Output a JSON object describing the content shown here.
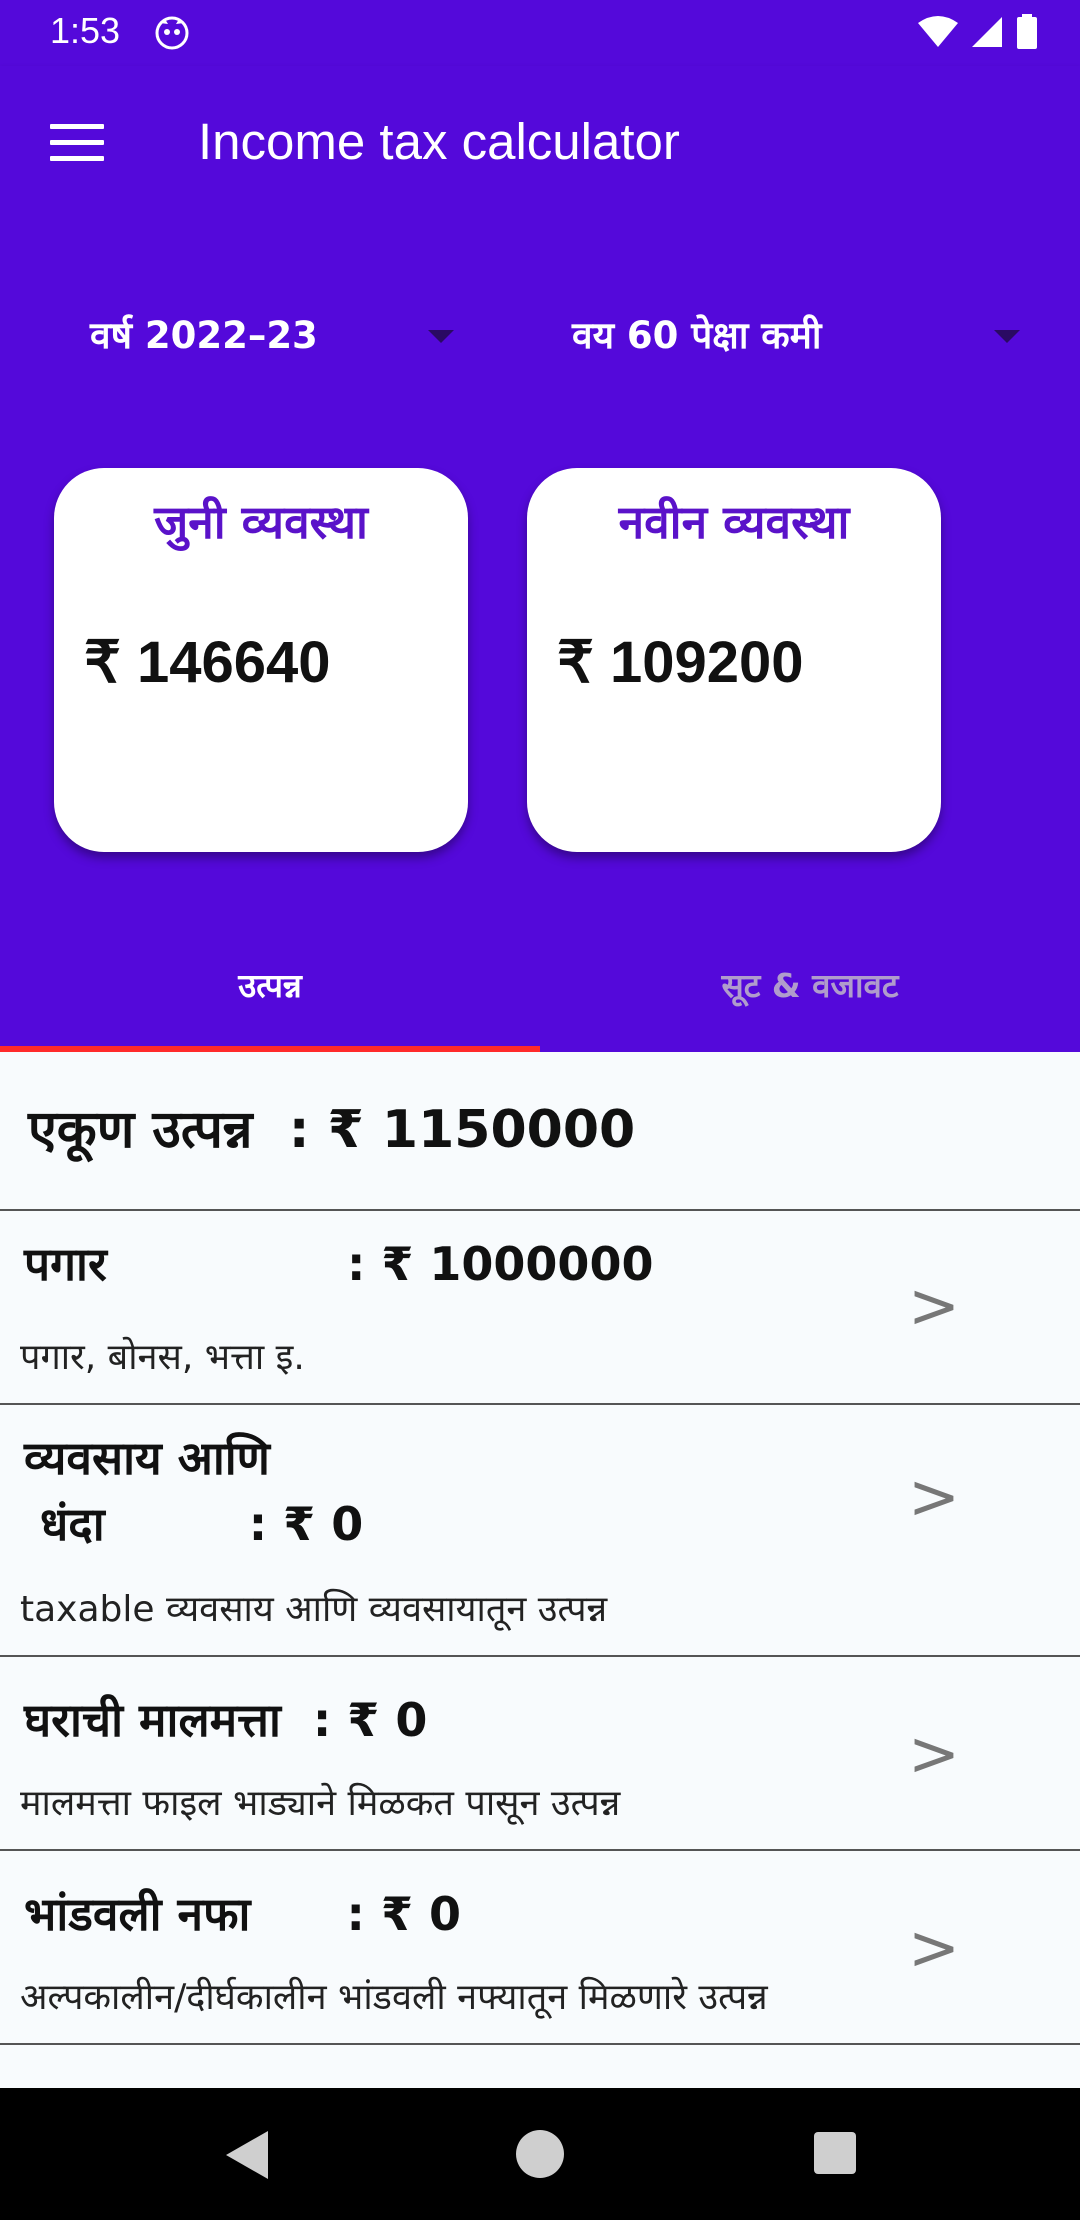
{
  "status_bar": {
    "time": "1:53",
    "icons": [
      "app-notification-icon",
      "wifi-icon",
      "signal-icon",
      "battery-icon"
    ]
  },
  "app_bar": {
    "title": "Income tax calculator",
    "menu_icon": "hamburger-menu-icon"
  },
  "selectors": {
    "year": "वर्ष 2022–23",
    "age": "वय 60 पेक्षा कमी"
  },
  "cards": {
    "old_regime": {
      "title": "जुनी व्यवस्था",
      "amount": "₹ 146640"
    },
    "new_regime": {
      "title": "नवीन व्यवस्था",
      "amount": "₹ 109200"
    }
  },
  "tabs": {
    "income": "उत्पन्न",
    "deductions": "सूट & वजावट",
    "selected": "income"
  },
  "total": {
    "text": "एकूण उत्पन्न  : ₹ 1150000"
  },
  "rows": {
    "salary": {
      "title": "पगार               : ₹ 1000000",
      "subtitle": "पगार, बोनस, भत्ता इ."
    },
    "business": {
      "title": "व्यवसाय आणि\n धंदा         : ₹ 0",
      "subtitle": "taxable व्यवसाय आणि व्यवसायातून उत्पन्न"
    },
    "house_property": {
      "title": "घराची मालमत्ता  : ₹ 0",
      "subtitle": "मालमत्ता फाइल भाड्याने मिळकत पासून उत्पन्न"
    },
    "capital_gains": {
      "title": "भांडवली नफा      : ₹ 0",
      "subtitle": "अल्पकालीन/दीर्घकालीन भांडवली नफ्यातून मिळणारे उत्पन्न"
    },
    "chevron": ">"
  },
  "colors": {
    "primary": "#5409da",
    "card_title": "#5a12c9",
    "tab_indicator": "#ff2a2a",
    "inactive_tab": "#b09ccc"
  }
}
